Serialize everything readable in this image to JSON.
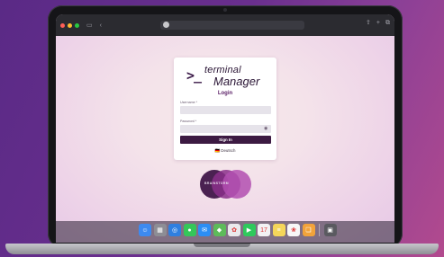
{
  "browser": {
    "icons": [
      "sidebar-icon",
      "back-icon",
      "shield-icon",
      "share-icon",
      "new-tab-icon",
      "tabs-icon"
    ]
  },
  "login": {
    "brand_prompt": ">_",
    "brand_line1": "terminal",
    "brand_line2": "Manager",
    "title": "Login",
    "username_label": "Username *",
    "username_value": "",
    "password_label": "Password *",
    "password_value": "",
    "signin_label": "Sign In",
    "language_label": "🇩🇪 Deutsch"
  },
  "company": {
    "name": "BRAINSTORM"
  },
  "dock": {
    "apps": [
      {
        "name": "finder",
        "glyph": "☺",
        "color": "#3d8af0"
      },
      {
        "name": "launchpad",
        "glyph": "▦",
        "color": "#8d8d95"
      },
      {
        "name": "safari",
        "glyph": "◎",
        "color": "#2f7fe0"
      },
      {
        "name": "messages",
        "glyph": "●",
        "color": "#34c759"
      },
      {
        "name": "mail",
        "glyph": "✉",
        "color": "#2c8ef5"
      },
      {
        "name": "maps",
        "glyph": "◆",
        "color": "#5dbb5a"
      },
      {
        "name": "photos",
        "glyph": "✿",
        "color": "#e9e9ec"
      },
      {
        "name": "facetime",
        "glyph": "▶",
        "color": "#2ec95c"
      },
      {
        "name": "calendar",
        "glyph": "17",
        "color": "#f2f2f4"
      },
      {
        "name": "notes",
        "glyph": "≡",
        "color": "#f5d65a"
      },
      {
        "name": "photo-library",
        "glyph": "❀",
        "color": "#f7f7f7"
      },
      {
        "name": "books",
        "glyph": "❏",
        "color": "#f2a33a"
      },
      {
        "name": "trash",
        "glyph": "▣",
        "color": "#5a5a60"
      }
    ]
  }
}
